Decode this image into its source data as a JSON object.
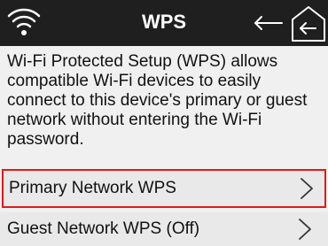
{
  "header": {
    "title": "WPS",
    "icons": [
      "wifi-icon",
      "back-arrow-icon",
      "home-icon"
    ]
  },
  "description": "Wi-Fi Protected Setup (WPS) allows compatible Wi-Fi devices to easily connect to this device's primary or guest network without entering the Wi-Fi password.",
  "menu": [
    {
      "label": "Primary Network WPS",
      "selected": true,
      "icon": "chevron-right-icon"
    },
    {
      "label": "Guest Network WPS (Off)",
      "selected": false,
      "icon": "chevron-right-icon"
    }
  ],
  "colors": {
    "header_bg": "#1f1f1f",
    "selection_border": "#e01818"
  }
}
